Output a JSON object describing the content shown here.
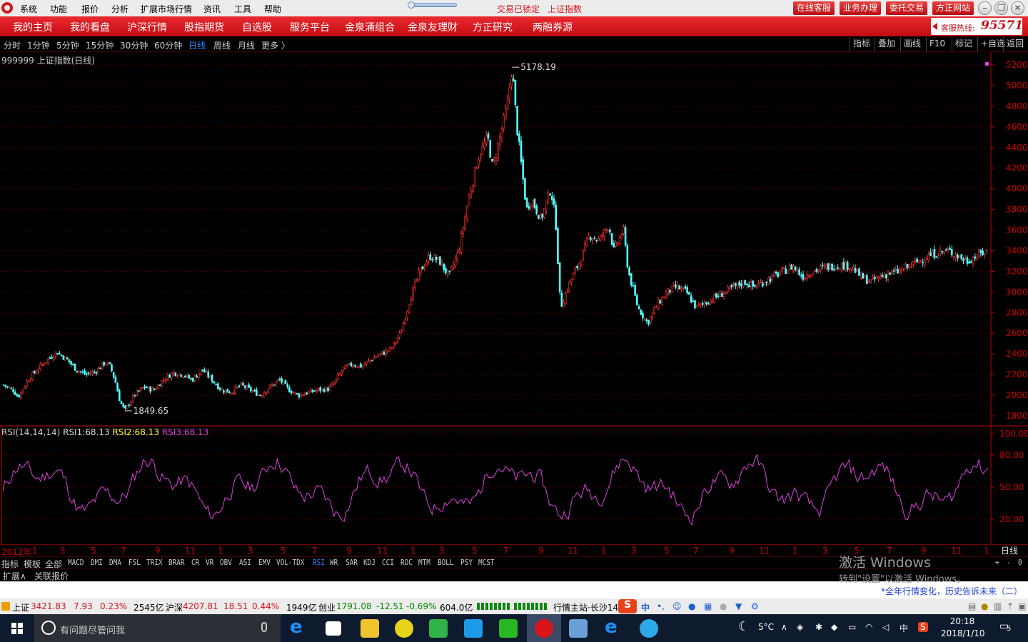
{
  "menubar": {
    "items": [
      "系统",
      "功能",
      "报价",
      "分析",
      "扩展市场行情",
      "资讯",
      "工具",
      "帮助"
    ],
    "status_locked": "交易已锁定",
    "status_index": "上证指数",
    "buttons": [
      "在线客服",
      "业务办理",
      "委托交易",
      "方正网站"
    ]
  },
  "navbar": {
    "items": [
      "我的主页",
      "我的看盘",
      "沪深行情",
      "股指期货",
      "自选股",
      "服务平台",
      "金泉涌组合",
      "金泉友理财",
      "方正研究",
      "两融券源"
    ],
    "hotline_label": "客服热线:",
    "hotline_number": "95571"
  },
  "periodbar": {
    "periods": [
      "分时",
      "1分钟",
      "5分钟",
      "15分钟",
      "30分钟",
      "60分钟",
      "日线",
      "周线",
      "月线",
      "更多 〉"
    ],
    "active": "日线",
    "right_buttons": [
      "指标",
      "叠加",
      "画线",
      "F10",
      "标记",
      "+自选",
      "返回"
    ]
  },
  "chart_title": "999999 上证指数(日线)",
  "chart_data": [
    {
      "type": "candlestick",
      "title": "999999 上证指数(日线)",
      "ylim": [
        1700,
        5300
      ],
      "yticks": [
        1800,
        2000,
        2200,
        2400,
        2600,
        2800,
        3000,
        3200,
        3400,
        3600,
        3800,
        4000,
        4200,
        4400,
        4600,
        4800,
        5000,
        5200
      ],
      "annotations": [
        {
          "label": "5178.19"
        },
        {
          "label": "1849.65"
        }
      ],
      "x_tick_labels": [
        "2012年",
        "1",
        "3",
        "5",
        "7",
        "9",
        "11",
        "1",
        "3",
        "5",
        "7",
        "9",
        "11",
        "1",
        "3",
        "5",
        "7",
        "9",
        "11",
        "1",
        "3",
        "5",
        "7",
        "9",
        "11",
        "1",
        "3",
        "5",
        "7",
        "9",
        "11",
        "1"
      ],
      "series": [
        {
          "close_path": [
            [
              0,
              2100
            ],
            [
              2,
              2050
            ],
            [
              3,
              1980
            ],
            [
              5,
              2150
            ],
            [
              8,
              2300
            ],
            [
              10,
              2380
            ],
            [
              11,
              2420
            ],
            [
              13,
              2350
            ],
            [
              15,
              2250
            ],
            [
              17,
              2200
            ],
            [
              19,
              2230
            ],
            [
              21,
              2320
            ],
            [
              22,
              2280
            ],
            [
              23,
              2150
            ],
            [
              24,
              1950
            ],
            [
              25,
              1849
            ],
            [
              27,
              2000
            ],
            [
              29,
              2080
            ],
            [
              31,
              2050
            ],
            [
              33,
              2150
            ],
            [
              35,
              2220
            ],
            [
              37,
              2200
            ],
            [
              39,
              2150
            ],
            [
              41,
              2250
            ],
            [
              43,
              2150
            ],
            [
              45,
              2050
            ],
            [
              47,
              2030
            ],
            [
              49,
              2100
            ],
            [
              51,
              2050
            ],
            [
              53,
              2000
            ],
            [
              55,
              2080
            ],
            [
              57,
              2150
            ],
            [
              59,
              2050
            ],
            [
              61,
              2000
            ],
            [
              63,
              2030
            ],
            [
              65,
              2050
            ],
            [
              67,
              2060
            ],
            [
              68,
              2100
            ],
            [
              70,
              2250
            ],
            [
              72,
              2300
            ],
            [
              74,
              2280
            ],
            [
              76,
              2350
            ],
            [
              78,
              2400
            ],
            [
              80,
              2450
            ],
            [
              82,
              2600
            ],
            [
              84,
              2950
            ],
            [
              86,
              3200
            ],
            [
              88,
              3350
            ],
            [
              90,
              3300
            ],
            [
              92,
              3150
            ],
            [
              94,
              3400
            ],
            [
              96,
              3900
            ],
            [
              98,
              4300
            ],
            [
              100,
              4500
            ],
            [
              101,
              4200
            ],
            [
              103,
              4600
            ],
            [
              104,
              4800
            ],
            [
              105,
              5178
            ],
            [
              106,
              4600
            ],
            [
              108,
              3800
            ],
            [
              109,
              3900
            ],
            [
              111,
              3700
            ],
            [
              113,
              4000
            ],
            [
              114,
              3700
            ],
            [
              115,
              2850
            ],
            [
              117,
              3100
            ],
            [
              119,
              3300
            ],
            [
              121,
              3550
            ],
            [
              123,
              3500
            ],
            [
              125,
              3650
            ],
            [
              126,
              3400
            ],
            [
              128,
              3600
            ],
            [
              129,
              3200
            ],
            [
              131,
              2850
            ],
            [
              133,
              2700
            ],
            [
              135,
              2880
            ],
            [
              137,
              3000
            ],
            [
              139,
              3050
            ],
            [
              141,
              3000
            ],
            [
              143,
              2850
            ],
            [
              145,
              2900
            ],
            [
              147,
              2950
            ],
            [
              149,
              3000
            ],
            [
              151,
              3050
            ],
            [
              153,
              3100
            ],
            [
              155,
              3050
            ],
            [
              157,
              3100
            ],
            [
              159,
              3150
            ],
            [
              161,
              3200
            ],
            [
              163,
              3250
            ],
            [
              165,
              3150
            ],
            [
              167,
              3200
            ],
            [
              169,
              3230
            ],
            [
              171,
              3250
            ],
            [
              173,
              3260
            ],
            [
              175,
              3250
            ],
            [
              177,
              3150
            ],
            [
              179,
              3100
            ],
            [
              181,
              3150
            ],
            [
              183,
              3180
            ],
            [
              185,
              3200
            ],
            [
              187,
              3250
            ],
            [
              189,
              3300
            ],
            [
              191,
              3350
            ],
            [
              193,
              3380
            ],
            [
              195,
              3400
            ],
            [
              197,
              3350
            ],
            [
              199,
              3300
            ],
            [
              201,
              3350
            ],
            [
              203,
              3400
            ]
          ]
        }
      ]
    },
    {
      "type": "line",
      "title": "RSI(14,14,14)",
      "ylim": [
        0,
        100
      ],
      "yticks": [
        20,
        50,
        80,
        100
      ],
      "ytick_labels": [
        "20.00",
        "50.00",
        "80.00",
        "100.00"
      ],
      "series": [
        {
          "name": "RSI1",
          "value": 68.13
        },
        {
          "name": "RSI2",
          "value": 68.13
        },
        {
          "name": "RSI3",
          "value": 68.13
        }
      ]
    }
  ],
  "rsi_label": {
    "prefix": "RSI(14,14,14)",
    "rsi1_name": "RSI1:",
    "rsi1": "68.13",
    "rsi2_name": "RSI2:",
    "rsi2": "68.13",
    "rsi3_name": "RSI3:",
    "rsi3": "68.13"
  },
  "period_label": "日线",
  "indicator_tabs": [
    "指标",
    "模板",
    "全部",
    "MACD",
    "DMI",
    "DMA",
    "FSL",
    "TRIX",
    "BRAR",
    "CR",
    "VR",
    "OBV",
    "ASI",
    "EMV",
    "VOL-TDX",
    "RSI",
    "WR",
    "SAR",
    "KDJ",
    "CCI",
    "ROC",
    "MTM",
    "BOLL",
    "PSY",
    "MCST"
  ],
  "indicator_active": "RSI",
  "ext_tabs": [
    "扩展∧",
    "关联报价"
  ],
  "news": "*全年行情变化，历史告诉未来（二）",
  "statusbar": {
    "sh_name": "上证",
    "sh_val": "3421.83",
    "sh_chg": "7.93",
    "sh_pct": "0.23%",
    "sh_amt": "2545亿",
    "hs_name": "沪深",
    "hs_val": "4207.81",
    "hs_chg": "18.51",
    "hs_pct": "0.44%",
    "hs_amt": "1949亿",
    "cy_name": "创业",
    "cy_val": "1791.08",
    "cy_chg": "-12.51",
    "cy_pct": "-0.69%",
    "cy_amt": "604.0亿",
    "server": "行情主站·长沙14",
    "ime": "中"
  },
  "watermark": {
    "line1": "激活 Windows",
    "line2": "转到\"设置\"以激活 Windows。"
  },
  "taskbar": {
    "search_placeholder": "有问题尽管问我",
    "temp": "5°C",
    "ime": "中",
    "time": "20:18",
    "date": "2018/1/10",
    "notif": "5"
  },
  "colors": {
    "up": "#ff3232",
    "down": "#54ffff",
    "rsi": "#e040e0",
    "grid": "#7a0000",
    "axis": "#c00000"
  }
}
